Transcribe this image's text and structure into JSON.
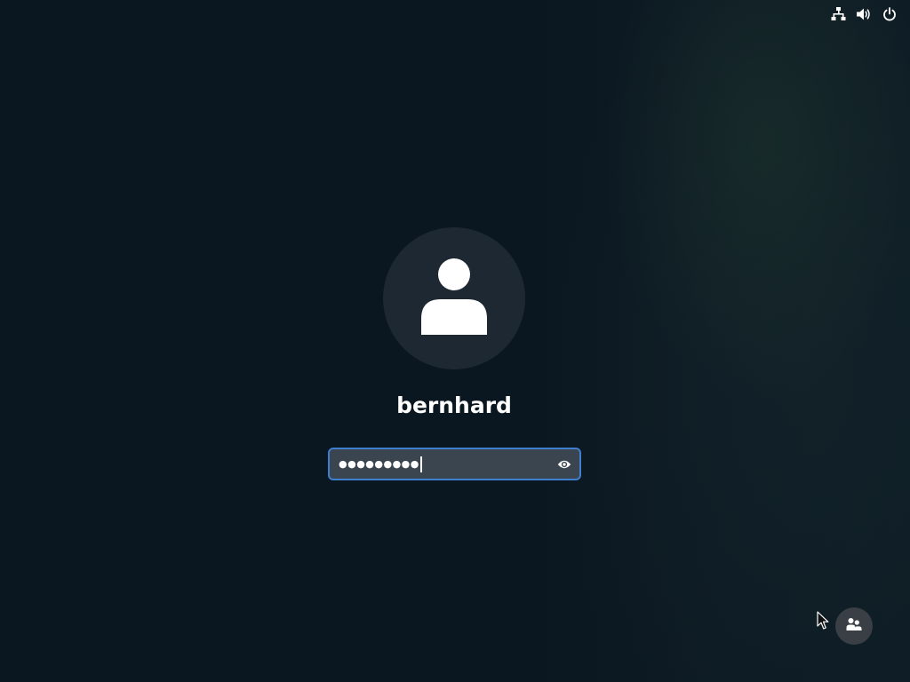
{
  "top_bar": {
    "icons": [
      "network-wired-icon",
      "volume-icon",
      "power-icon"
    ]
  },
  "login": {
    "avatar_icon": "user-avatar-icon",
    "username": "bernhard",
    "password_masked": "●●●●●●●●●",
    "reveal_icon": "eye-icon"
  },
  "bottom_bar": {
    "switch_user_icon": "users-icon"
  },
  "colors": {
    "background": "#0a1620",
    "avatar_bg": "#1d2832",
    "field_bg": "#3a4550",
    "field_focus_border": "#3f7fd0",
    "round_button_bg": "#3a3f45",
    "foreground": "#ffffff"
  }
}
